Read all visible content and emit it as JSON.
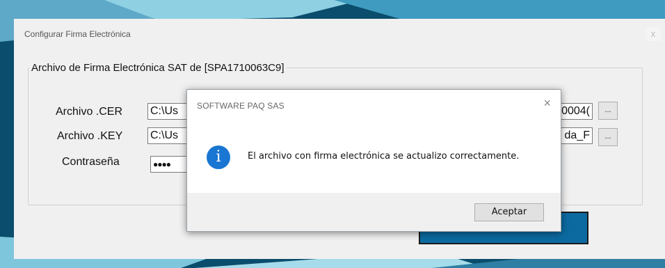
{
  "main_window": {
    "title": "Configurar Firma Electrónica",
    "close_label": "x",
    "group_title": "Archivo de Firma Electrónica SAT de [SPA1710063C9]",
    "rows": [
      {
        "label": "Archivo .CER",
        "value_left": "C:\\Us",
        "value_right": "0004(",
        "browse_label": "..."
      },
      {
        "label": "Archivo .KEY",
        "value_left": "C:\\Us",
        "value_right": "da_F",
        "browse_label": "..."
      },
      {
        "label": "Contraseña",
        "value_left": "●●●●"
      }
    ]
  },
  "dialog": {
    "title": "SOFTWARE PAQ SAS",
    "close_label": "×",
    "icon_glyph": "i",
    "message": "El archivo con firma electrónica se actualizo correctamente.",
    "ok_label": "Aceptar"
  },
  "colors": {
    "info_icon": "#1976d2",
    "primary_button": "#0c6aa0"
  }
}
